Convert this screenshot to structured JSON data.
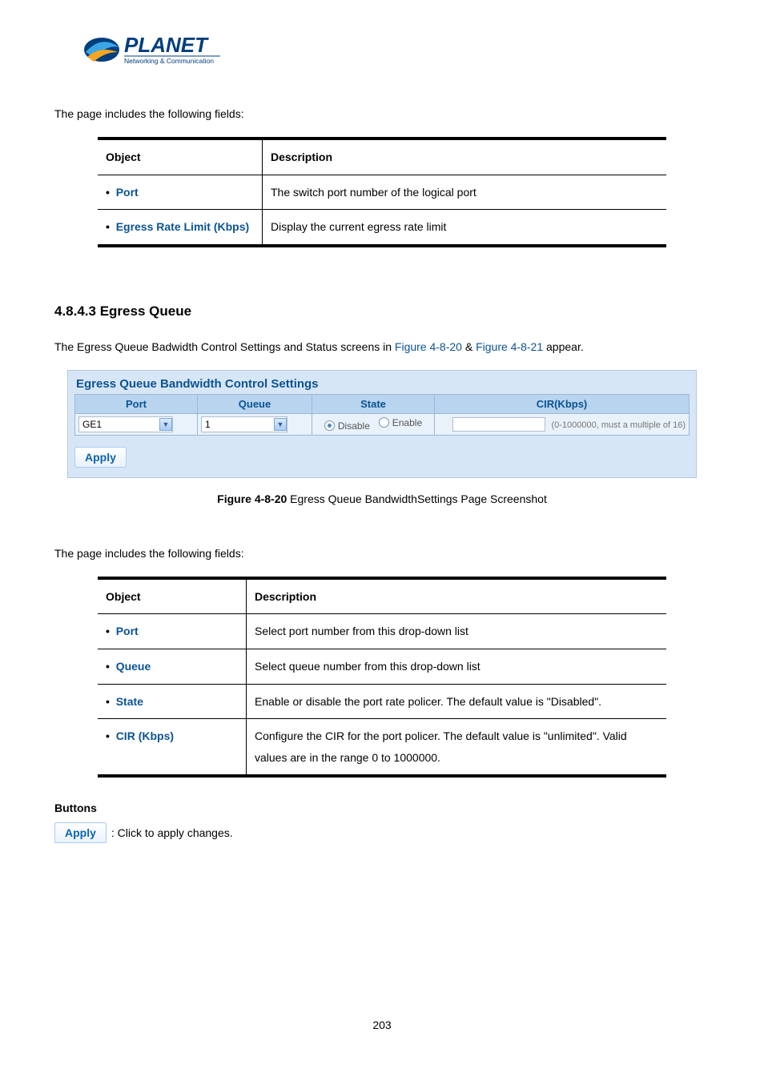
{
  "logo": {
    "brand": "PLANET",
    "tagline": "Networking & Communication"
  },
  "intro1": "The page includes the following fields:",
  "table1": {
    "head": {
      "obj": "Object",
      "desc": "Description"
    },
    "rows": [
      {
        "obj": "Port",
        "desc": "The switch port number of the logical port"
      },
      {
        "obj": "Egress Rate Limit (Kbps)",
        "desc": "Display the current egress rate limit"
      }
    ]
  },
  "section_heading": "4.8.4.3 Egress Queue",
  "section_intro": {
    "pre": "The Egress Queue Badwidth Control Settings and Status screens in ",
    "link1": "Figure 4-8-20",
    "amp": " & ",
    "link2": "Figure 4-8-21",
    "post": " appear."
  },
  "screenshot": {
    "title": "Egress Queue Bandwidth Control Settings",
    "headers": {
      "port": "Port",
      "queue": "Queue",
      "state": "State",
      "cir": "CIR(Kbps)"
    },
    "row": {
      "port_value": "GE1",
      "queue_value": "1",
      "state_disable": "Disable",
      "state_enable": "Enable",
      "cir_value": "",
      "cir_hint": "(0-1000000, must a multiple of 16)"
    },
    "apply": "Apply"
  },
  "caption": {
    "bold": "Figure 4-8-20",
    "rest": " Egress Queue BandwidthSettings Page Screenshot"
  },
  "intro2": "The page includes the following fields:",
  "table2": {
    "head": {
      "obj": "Object",
      "desc": "Description"
    },
    "rows": [
      {
        "obj": "Port",
        "desc": "Select port number from this drop-down list"
      },
      {
        "obj": "Queue",
        "desc": "Select queue number from this drop-down list"
      },
      {
        "obj": "State",
        "desc": "Enable or disable the port rate policer. The default value is \"Disabled\"."
      },
      {
        "obj": "CIR (Kbps)",
        "desc": "Configure the CIR for the port policer. The default value is \"unlimited\". Valid values are in the range 0 to 1000000."
      }
    ]
  },
  "buttons": {
    "heading": "Buttons",
    "apply_label": "Apply",
    "apply_desc": ": Click to apply changes."
  },
  "page_number": "203"
}
